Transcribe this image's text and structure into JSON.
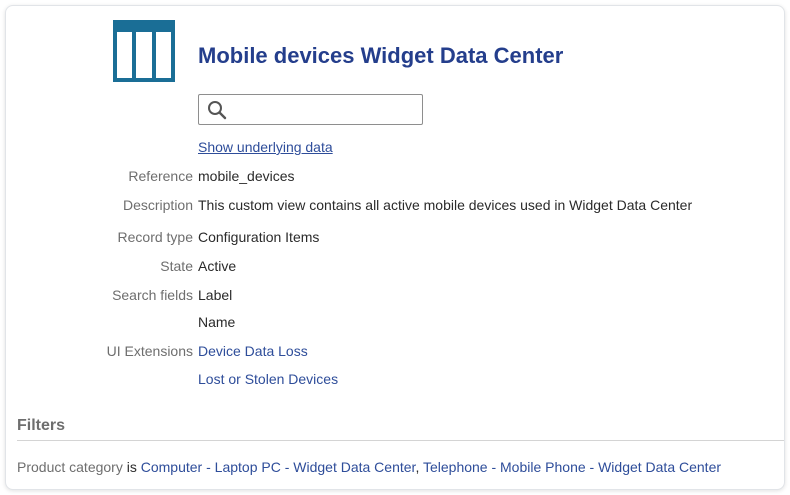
{
  "header": {
    "title": "Mobile devices Widget Data Center",
    "icon": "table-icon",
    "accent_color": "#1a6e96",
    "title_color": "#243e8c"
  },
  "search": {
    "value": "",
    "placeholder": "",
    "icon": "search-icon"
  },
  "show_underlying_data": "Show underlying data",
  "properties": {
    "reference": {
      "label": "Reference",
      "value": "mobile_devices"
    },
    "description": {
      "label": "Description",
      "value": "This custom view contains all active mobile devices used in Widget Data Center"
    },
    "record_type": {
      "label": "Record type",
      "value": "Configuration Items"
    },
    "state": {
      "label": "State",
      "value": "Active"
    },
    "search_fields": {
      "label": "Search fields",
      "values": [
        "Label",
        "Name"
      ]
    },
    "ui_extensions": {
      "label": "UI Extensions",
      "values": [
        "Device Data Loss",
        "Lost or Stolen Devices"
      ]
    }
  },
  "filters": {
    "heading": "Filters",
    "field": "Product category",
    "operator": "is",
    "value_1": "Computer - Laptop PC - Widget Data Center",
    "separator": ",",
    "value_2": "Telephone - Mobile Phone - Widget Data Center"
  }
}
